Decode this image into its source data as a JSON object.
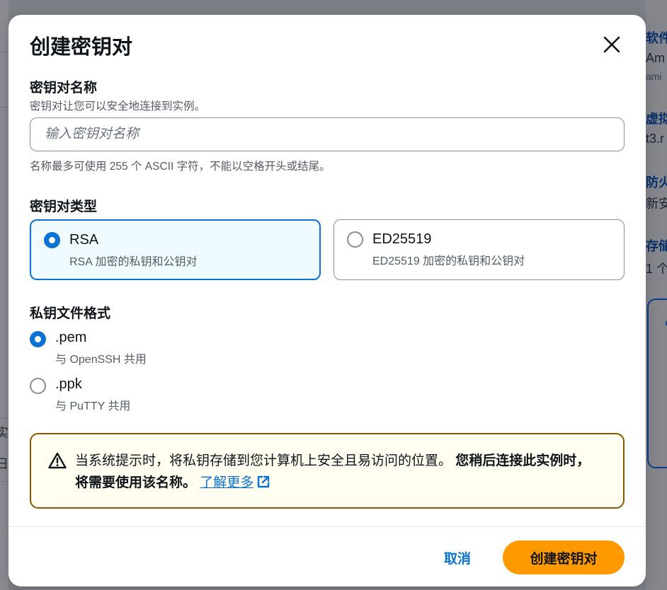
{
  "background": {
    "right_fragments": [
      "软件",
      "Am",
      "ami",
      "虚拟",
      "t3.r",
      "防火",
      "新安",
      "存储",
      "1 个"
    ],
    "left_fragments": [
      "实",
      "日"
    ]
  },
  "modal": {
    "title": "创建密钥对",
    "close_icon": "close-icon",
    "key_name": {
      "label": "密钥对名称",
      "description": "密钥对让您可以安全地连接到实例。",
      "placeholder": "输入密钥对名称",
      "value": "",
      "constraint": "名称最多可使用 255 个 ASCII 字符，不能以空格开头或结尾。"
    },
    "key_type": {
      "label": "密钥对类型",
      "options": [
        {
          "title": "RSA",
          "subtitle": "RSA 加密的私钥和公钥对",
          "selected": true
        },
        {
          "title": "ED25519",
          "subtitle": "ED25519 加密的私钥和公钥对",
          "selected": false
        }
      ]
    },
    "file_format": {
      "label": "私钥文件格式",
      "options": [
        {
          "title": ".pem",
          "subtitle": "与 OpenSSH 共用",
          "selected": true
        },
        {
          "title": ".ppk",
          "subtitle": "与 PuTTY 共用",
          "selected": false
        }
      ]
    },
    "alert": {
      "icon": "warning-icon",
      "text": "当系统提示时，将私钥存储到您计算机上安全且易访问的位置。",
      "bold_text": "您稍后连接此实例时，将需要使用该名称。",
      "link_text": "了解更多",
      "link_icon": "external-link-icon"
    },
    "footer": {
      "cancel_label": "取消",
      "create_label": "创建密钥对"
    }
  },
  "colors": {
    "accent": "#0972d3",
    "primary_button": "#ff9900",
    "warning_border": "#855900",
    "warning_bg": "#fffef0"
  }
}
